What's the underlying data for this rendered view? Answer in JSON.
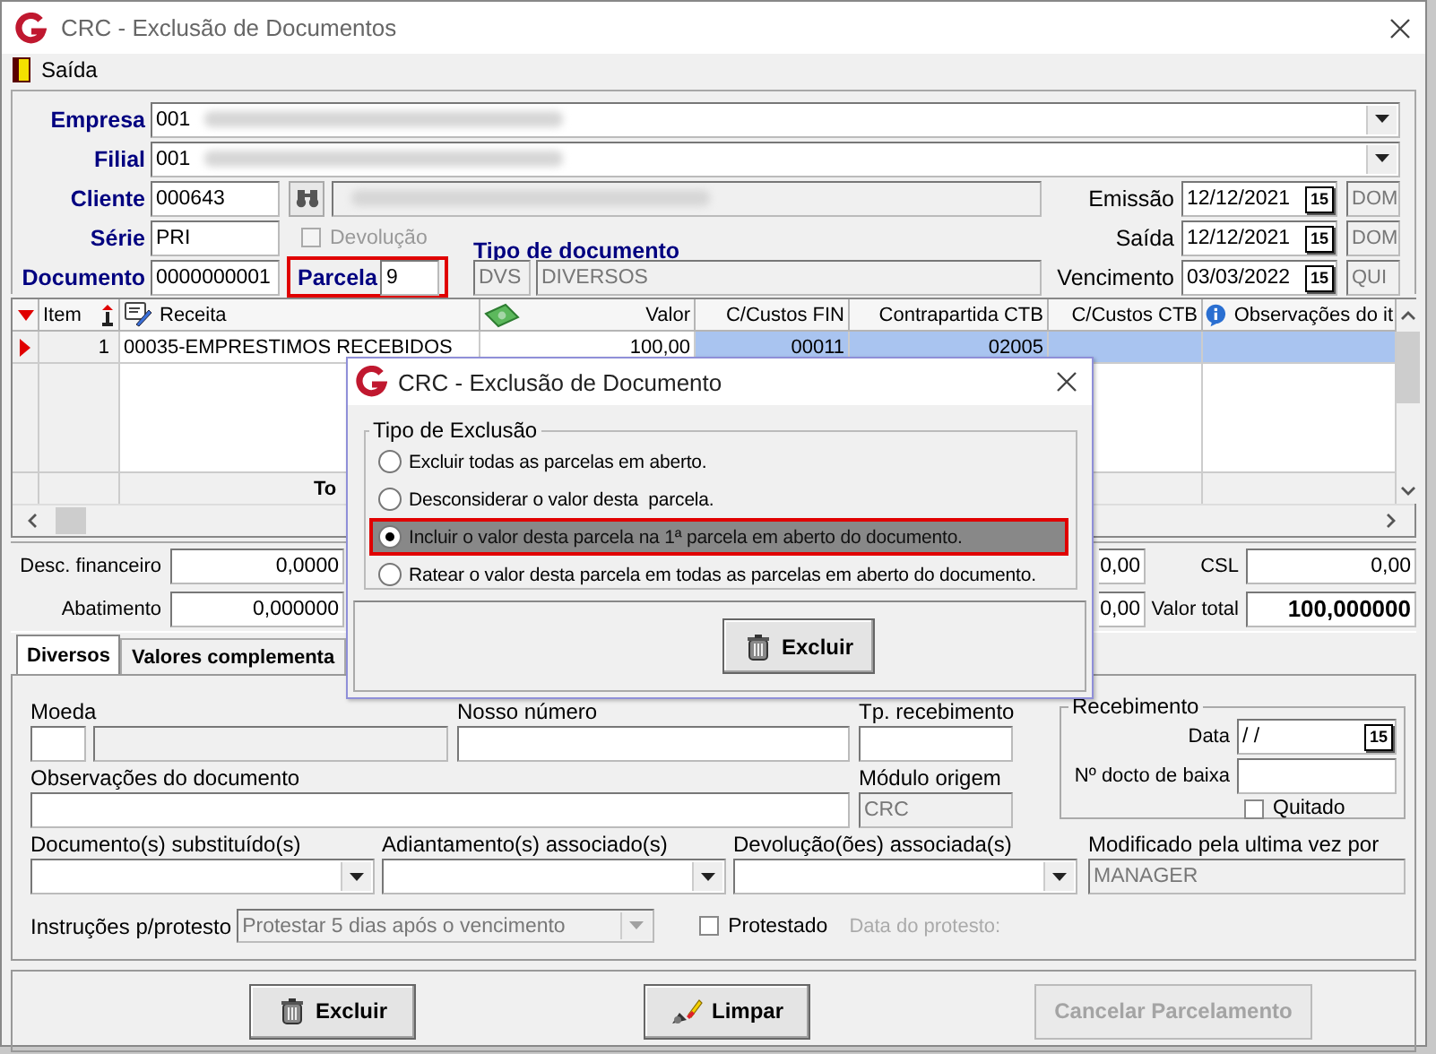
{
  "window": {
    "title": "CRC - Exclusão de Documentos"
  },
  "menu": [
    {
      "label": "Saída"
    }
  ],
  "header": {
    "empresa": {
      "label": "Empresa",
      "value": "001",
      "redacted": true
    },
    "filial": {
      "label": "Filial",
      "value": "001",
      "redacted": true
    },
    "cliente": {
      "label": "Cliente",
      "code": "000643",
      "redacted": true
    },
    "serie": {
      "label": "Série",
      "value": "PRI"
    },
    "devolucao": {
      "label": "Devolução",
      "checked": false,
      "disabled": true
    },
    "tipo_documento_label": "Tipo de documento",
    "documento": {
      "label": "Documento",
      "value": "0000000001"
    },
    "parcela": {
      "label": "Parcela",
      "value": "9",
      "highlighted": true
    },
    "tipo_documento": {
      "code": "DVS",
      "name": "DIVERSOS",
      "disabled": true
    },
    "dates": [
      {
        "label": "Emissão",
        "value": "12/12/2021",
        "calendar": "15",
        "weekday": "DOM"
      },
      {
        "label": "Saída",
        "value": "12/12/2021",
        "calendar": "15",
        "weekday": "DOM"
      },
      {
        "label": "Vencimento",
        "value": "03/03/2022",
        "calendar": "15",
        "weekday": "QUI"
      }
    ]
  },
  "grid": {
    "columns": [
      {
        "label": "Item"
      },
      {
        "label": "Receita"
      },
      {
        "label": "Valor"
      },
      {
        "label": "C/Custos FIN"
      },
      {
        "label": "Contrapartida CTB"
      },
      {
        "label": "C/Custos CTB"
      },
      {
        "label": "Observações do it"
      }
    ],
    "rows": [
      {
        "selected": true,
        "cells": [
          "1",
          "00035-EMPRESTIMOS RECEBIDOS",
          "100,00",
          "00011",
          "02005"
        ]
      }
    ],
    "footer": "To"
  },
  "totals": [
    {
      "label": "Desc. financeiro",
      "value": "0,0000",
      "column_3": "0,00",
      "label_2": "CSL",
      "value_2": "0,00",
      "emphasized": false
    },
    {
      "label": "Abatimento",
      "value": "0,000000",
      "column_3": "0,00",
      "label_2": "Valor total",
      "value_2": "100,000000",
      "emphasized": true
    }
  ],
  "tabs": [
    {
      "label": "Diversos",
      "selected": true
    },
    {
      "label": "Valores complementa",
      "selected": false
    }
  ],
  "diversos": {
    "moeda": {
      "label": "Moeda"
    },
    "nosso_numero": {
      "label": "Nosso número"
    },
    "tp_recebimento": {
      "label": "Tp. recebimento"
    },
    "observacoes": {
      "label": "Observações do documento"
    },
    "modulo_origem": {
      "label": "Módulo origem",
      "value": "CRC",
      "disabled": true
    },
    "recebimento": {
      "title": "Recebimento",
      "data": {
        "label": "Data",
        "value": "/ /",
        "calendar": "15"
      },
      "docto_baixa": {
        "label": "Nº docto de baixa"
      },
      "quitado": {
        "label": "Quitado",
        "checked": false
      }
    },
    "combos": [
      {
        "label": "Documento(s) substituído(s)"
      },
      {
        "label": "Adiantamento(s) associado(s)"
      },
      {
        "label": "Devolução(ões) associada(s)"
      }
    ],
    "modificado": {
      "label": "Modificado pela ultima vez por",
      "value": "MANAGER",
      "disabled": true
    },
    "instrucoes": {
      "label": "Instruções p/protesto",
      "value": "Protestar 5 dias após o vencimento",
      "disabled": true
    },
    "protestado": {
      "label": "Protestado",
      "checked": false
    },
    "data_protesto": {
      "label": "Data do protesto:",
      "disabled": true
    }
  },
  "buttons": [
    {
      "label": "Excluir",
      "kind": "trash",
      "disabled": false
    },
    {
      "label": "Limpar",
      "kind": "eraser",
      "disabled": false
    },
    {
      "label": "Cancelar Parcelamento",
      "kind": "plain",
      "disabled": true
    }
  ],
  "dialog": {
    "title": "CRC - Exclusão de Documento",
    "group": "Tipo de Exclusão",
    "options": [
      {
        "label": "Excluir todas as parcelas em aberto.",
        "selected": false,
        "highlighted": false
      },
      {
        "label": "Desconsiderar o valor desta  parcela.",
        "selected": false,
        "highlighted": false
      },
      {
        "label": "Incluir o valor desta parcela na 1ª parcela em aberto do documento.",
        "selected": true,
        "highlighted": true
      },
      {
        "label": "Ratear o valor desta parcela em todas as parcelas em aberto do documento.",
        "selected": false,
        "highlighted": false
      }
    ],
    "button": {
      "label": "Excluir",
      "kind": "trash"
    }
  }
}
